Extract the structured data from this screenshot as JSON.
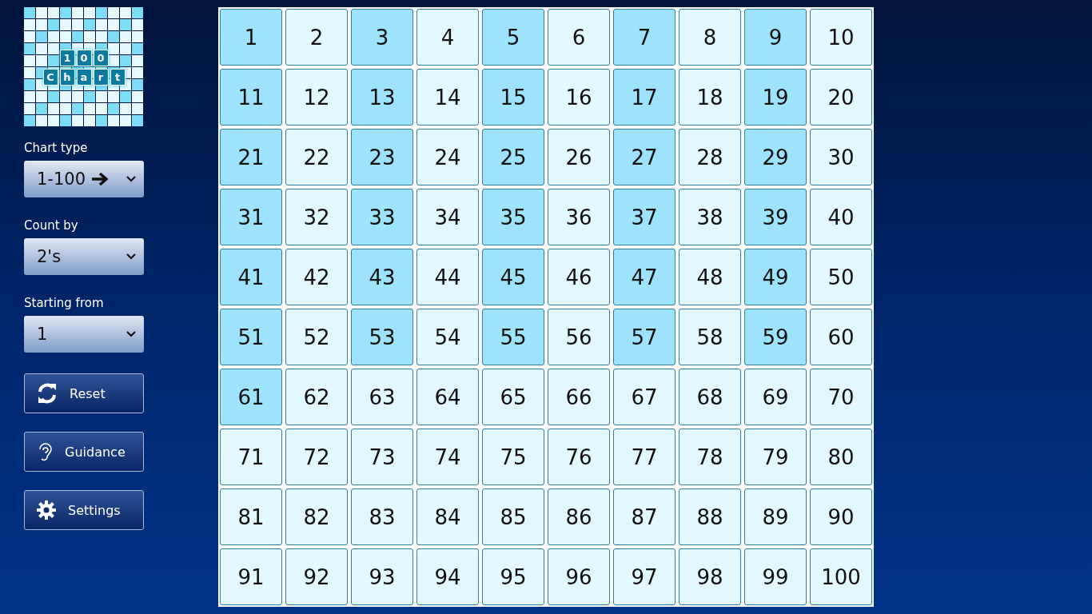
{
  "logo": {
    "line_1": [
      "1",
      "0",
      "0"
    ],
    "line_2": [
      "C",
      "h",
      "a",
      "r",
      "t"
    ]
  },
  "controls": [
    {
      "label": "Chart type",
      "value": "1-100",
      "arrow": true
    },
    {
      "label": "Count by",
      "value": "2's",
      "arrow": false
    },
    {
      "label": "Starting from",
      "value": "1",
      "arrow": false
    }
  ],
  "buttons": [
    {
      "kind": "reset",
      "label": "Reset"
    },
    {
      "kind": "guidance",
      "label": "Guidance"
    },
    {
      "kind": "settings",
      "label": "Settings"
    }
  ],
  "cells": [
    {
      "n": "1",
      "highlighted": true
    },
    {
      "n": "2",
      "highlighted": false
    },
    {
      "n": "3",
      "highlighted": true
    },
    {
      "n": "4",
      "highlighted": false
    },
    {
      "n": "5",
      "highlighted": true
    },
    {
      "n": "6",
      "highlighted": false
    },
    {
      "n": "7",
      "highlighted": true
    },
    {
      "n": "8",
      "highlighted": false
    },
    {
      "n": "9",
      "highlighted": true
    },
    {
      "n": "10",
      "highlighted": false
    },
    {
      "n": "11",
      "highlighted": true
    },
    {
      "n": "12",
      "highlighted": false
    },
    {
      "n": "13",
      "highlighted": true
    },
    {
      "n": "14",
      "highlighted": false
    },
    {
      "n": "15",
      "highlighted": true
    },
    {
      "n": "16",
      "highlighted": false
    },
    {
      "n": "17",
      "highlighted": true
    },
    {
      "n": "18",
      "highlighted": false
    },
    {
      "n": "19",
      "highlighted": true
    },
    {
      "n": "20",
      "highlighted": false
    },
    {
      "n": "21",
      "highlighted": true
    },
    {
      "n": "22",
      "highlighted": false
    },
    {
      "n": "23",
      "highlighted": true
    },
    {
      "n": "24",
      "highlighted": false
    },
    {
      "n": "25",
      "highlighted": true
    },
    {
      "n": "26",
      "highlighted": false
    },
    {
      "n": "27",
      "highlighted": true
    },
    {
      "n": "28",
      "highlighted": false
    },
    {
      "n": "29",
      "highlighted": true
    },
    {
      "n": "30",
      "highlighted": false
    },
    {
      "n": "31",
      "highlighted": true
    },
    {
      "n": "32",
      "highlighted": false
    },
    {
      "n": "33",
      "highlighted": true
    },
    {
      "n": "34",
      "highlighted": false
    },
    {
      "n": "35",
      "highlighted": true
    },
    {
      "n": "36",
      "highlighted": false
    },
    {
      "n": "37",
      "highlighted": true
    },
    {
      "n": "38",
      "highlighted": false
    },
    {
      "n": "39",
      "highlighted": true
    },
    {
      "n": "40",
      "highlighted": false
    },
    {
      "n": "41",
      "highlighted": true
    },
    {
      "n": "42",
      "highlighted": false
    },
    {
      "n": "43",
      "highlighted": true
    },
    {
      "n": "44",
      "highlighted": false
    },
    {
      "n": "45",
      "highlighted": true
    },
    {
      "n": "46",
      "highlighted": false
    },
    {
      "n": "47",
      "highlighted": true
    },
    {
      "n": "48",
      "highlighted": false
    },
    {
      "n": "49",
      "highlighted": true
    },
    {
      "n": "50",
      "highlighted": false
    },
    {
      "n": "51",
      "highlighted": true
    },
    {
      "n": "52",
      "highlighted": false
    },
    {
      "n": "53",
      "highlighted": true
    },
    {
      "n": "54",
      "highlighted": false
    },
    {
      "n": "55",
      "highlighted": true
    },
    {
      "n": "56",
      "highlighted": false
    },
    {
      "n": "57",
      "highlighted": true
    },
    {
      "n": "58",
      "highlighted": false
    },
    {
      "n": "59",
      "highlighted": true
    },
    {
      "n": "60",
      "highlighted": false
    },
    {
      "n": "61",
      "highlighted": true
    },
    {
      "n": "62",
      "highlighted": false
    },
    {
      "n": "63",
      "highlighted": false
    },
    {
      "n": "64",
      "highlighted": false
    },
    {
      "n": "65",
      "highlighted": false
    },
    {
      "n": "66",
      "highlighted": false
    },
    {
      "n": "67",
      "highlighted": false
    },
    {
      "n": "68",
      "highlighted": false
    },
    {
      "n": "69",
      "highlighted": false
    },
    {
      "n": "70",
      "highlighted": false
    },
    {
      "n": "71",
      "highlighted": false
    },
    {
      "n": "72",
      "highlighted": false
    },
    {
      "n": "73",
      "highlighted": false
    },
    {
      "n": "74",
      "highlighted": false
    },
    {
      "n": "75",
      "highlighted": false
    },
    {
      "n": "76",
      "highlighted": false
    },
    {
      "n": "77",
      "highlighted": false
    },
    {
      "n": "78",
      "highlighted": false
    },
    {
      "n": "79",
      "highlighted": false
    },
    {
      "n": "80",
      "highlighted": false
    },
    {
      "n": "81",
      "highlighted": false
    },
    {
      "n": "82",
      "highlighted": false
    },
    {
      "n": "83",
      "highlighted": false
    },
    {
      "n": "84",
      "highlighted": false
    },
    {
      "n": "85",
      "highlighted": false
    },
    {
      "n": "86",
      "highlighted": false
    },
    {
      "n": "87",
      "highlighted": false
    },
    {
      "n": "88",
      "highlighted": false
    },
    {
      "n": "89",
      "highlighted": false
    },
    {
      "n": "90",
      "highlighted": false
    },
    {
      "n": "91",
      "highlighted": false
    },
    {
      "n": "92",
      "highlighted": false
    },
    {
      "n": "93",
      "highlighted": false
    },
    {
      "n": "94",
      "highlighted": false
    },
    {
      "n": "95",
      "highlighted": false
    },
    {
      "n": "96",
      "highlighted": false
    },
    {
      "n": "97",
      "highlighted": false
    },
    {
      "n": "98",
      "highlighted": false
    },
    {
      "n": "99",
      "highlighted": false
    },
    {
      "n": "100",
      "highlighted": false
    }
  ]
}
